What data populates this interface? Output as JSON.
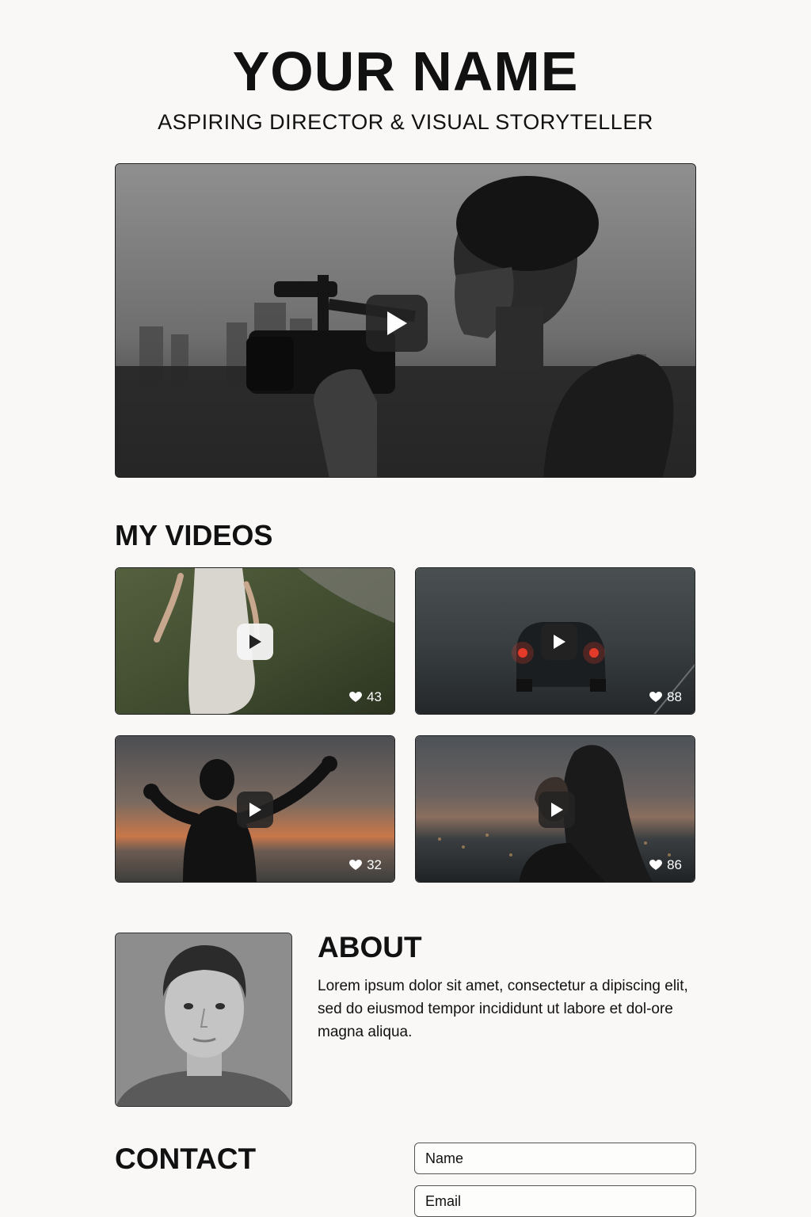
{
  "header": {
    "title": "YOUR NAME",
    "subtitle": "ASPIRING DIRECTOR & VISUAL STORYTELLER"
  },
  "hero": {
    "icon": "play-icon"
  },
  "videos": {
    "title": "MY VIDEOS",
    "items": [
      {
        "likes": "43",
        "scene": "woman in white dress walking on grassy hill"
      },
      {
        "likes": "88",
        "scene": "car with red tail lights in fog"
      },
      {
        "likes": "32",
        "scene": "silhouette with raised arms at sunset"
      },
      {
        "likes": "86",
        "scene": "woman in profile over city at dusk"
      }
    ]
  },
  "about": {
    "title": "ABOUT",
    "text": "Lorem ipsum dolor sit amet, consectetur a dipiscing elit, sed do eiusmod tempor incididunt ut labore et dol-ore magna aliqua."
  },
  "contact": {
    "title": "CONTACT",
    "name_placeholder": "Name",
    "email_placeholder": "Email"
  },
  "colors": {
    "background": "#f9f8f6",
    "text": "#111111",
    "play_button_dark": "#232323",
    "play_button_light": "#f5f5f5"
  }
}
